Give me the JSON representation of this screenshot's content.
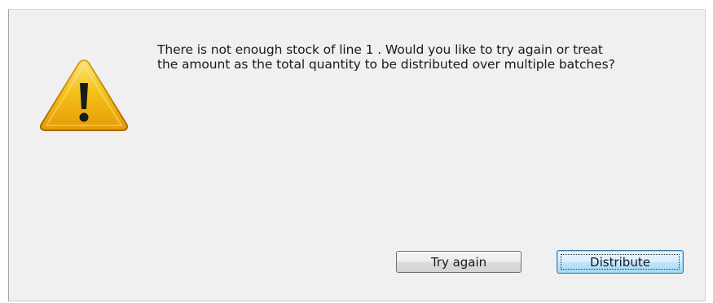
{
  "dialog": {
    "icon": "warning-icon",
    "message": "There is not enough stock of line 1 . Would you like to try again or treat\nthe amount as the total quantity to be distributed over multiple batches?",
    "buttons": {
      "try_again": "Try again",
      "distribute": "Distribute"
    }
  },
  "colors": {
    "dialog_background": "#f0f0f0",
    "warning_yellow": "#f5c21a",
    "focus_blue": "#3c7fb1"
  }
}
